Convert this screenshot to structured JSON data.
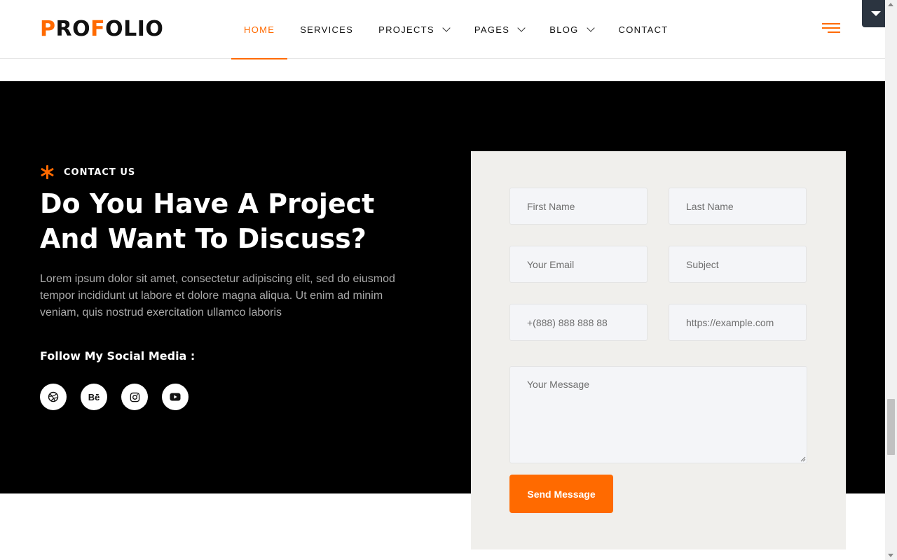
{
  "brand": {
    "logo_part1": "P",
    "logo_part2": "RO",
    "logo_part3": "F",
    "logo_part4": "OLIO",
    "accent_color": "#ff6a00"
  },
  "nav": {
    "items": [
      {
        "label": "HOME",
        "active": true,
        "dropdown": false
      },
      {
        "label": "SERVICES",
        "active": false,
        "dropdown": false
      },
      {
        "label": "PROJECTS",
        "active": false,
        "dropdown": true
      },
      {
        "label": "PAGES",
        "active": false,
        "dropdown": true
      },
      {
        "label": "BLOG",
        "active": false,
        "dropdown": true
      },
      {
        "label": "CONTACT",
        "active": false,
        "dropdown": false
      }
    ],
    "menu_icon": "hamburger-icon"
  },
  "contact": {
    "eyebrow": "CONTACT US",
    "headline_line1": "Do You Have A Project",
    "headline_line2": "And Want To Discuss?",
    "paragraph": "Lorem ipsum dolor sit amet, consectetur adipiscing elit, sed do eiusmod tempor incididunt ut labore et dolore magna aliqua. Ut enim ad minim veniam, quis nostrud exercitation ullamco laboris",
    "follow_label": "Follow My Social Media :",
    "socials": [
      {
        "icon": "dribbble-icon"
      },
      {
        "icon": "behance-icon",
        "text": "Bē"
      },
      {
        "icon": "instagram-icon"
      },
      {
        "icon": "youtube-icon"
      }
    ]
  },
  "form": {
    "first_name_placeholder": "First Name",
    "last_name_placeholder": "Last Name",
    "email_placeholder": "Your Email",
    "subject_placeholder": "Subject",
    "phone_placeholder": "+(888) 888 888 88",
    "website_placeholder": "https://example.com",
    "message_placeholder": "Your Message",
    "submit_label": "Send Message"
  }
}
